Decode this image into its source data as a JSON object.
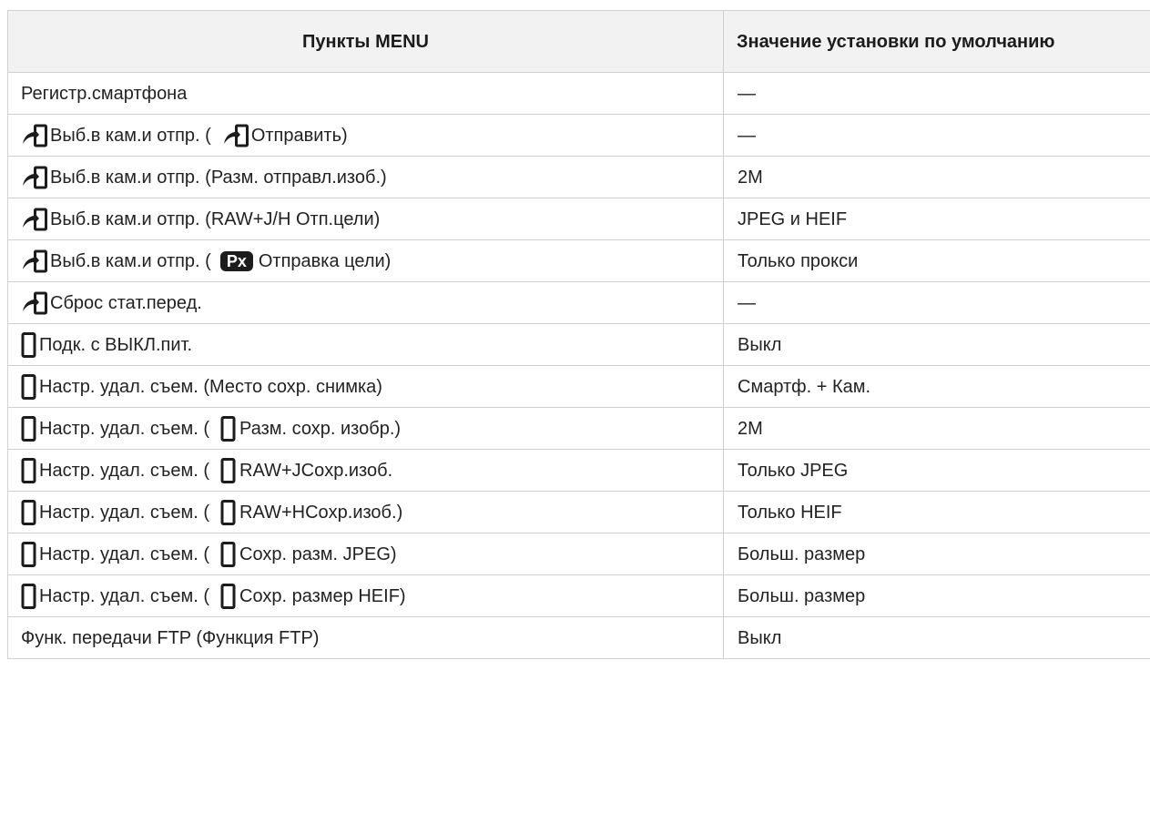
{
  "table": {
    "headers": {
      "menu": "Пункты MENU",
      "default": "Значение установки по умолчанию"
    },
    "rows": [
      {
        "icon": "",
        "parts": [
          "Регистр.смартфона"
        ],
        "value": "—"
      },
      {
        "icon": "send-icon",
        "parts": [
          "Выб.в кам.и отпр. (",
          "Отправить)"
        ],
        "inner_icon": "send-icon",
        "value": "—"
      },
      {
        "icon": "send-icon",
        "parts": [
          "Выб.в кам.и отпр. (Разм. отправл.изоб.)"
        ],
        "value": "2M"
      },
      {
        "icon": "send-icon",
        "parts": [
          "Выб.в кам.и отпр. (RAW+J/H Отп.цели)"
        ],
        "value": "JPEG и HEIF"
      },
      {
        "icon": "send-icon",
        "parts": [
          "Выб.в кам.и отпр. (",
          "Отправка цели)"
        ],
        "inner_badge": "Px",
        "value": "Только прокси"
      },
      {
        "icon": "send-icon",
        "parts": [
          "Сброс стат.перед."
        ],
        "value": "—"
      },
      {
        "icon": "smartphone-icon",
        "parts": [
          "Подк. с ВЫКЛ.пит."
        ],
        "value": "Выкл"
      },
      {
        "icon": "smartphone-icon",
        "parts": [
          "Настр. удал. съем. (Место сохр. снимка)"
        ],
        "value": "Смартф. + Кам."
      },
      {
        "icon": "smartphone-icon",
        "parts": [
          "Настр. удал. съем. (",
          "Разм. сохр. изобр.)"
        ],
        "inner_icon": "smartphone-icon",
        "value": "2M"
      },
      {
        "icon": "smartphone-icon",
        "parts": [
          "Настр. удал. съем. (",
          "RAW+JCoxp.изоб."
        ],
        "inner_icon": "smartphone-icon",
        "value": "Только JPEG"
      },
      {
        "icon": "smartphone-icon",
        "parts": [
          "Настр. удал. съем. (",
          "RAW+HCoxp.изоб.)"
        ],
        "inner_icon": "smartphone-icon",
        "value": "Только HEIF"
      },
      {
        "icon": "smartphone-icon",
        "parts": [
          "Настр. удал. съем. (",
          "Сохр. разм. JPEG)"
        ],
        "inner_icon": "smartphone-icon",
        "value": "Больш. размер"
      },
      {
        "icon": "smartphone-icon",
        "parts": [
          "Настр. удал. съем. (",
          "Сохр. размер HEIF)"
        ],
        "inner_icon": "smartphone-icon",
        "value": "Больш. размер"
      },
      {
        "icon": "",
        "parts": [
          "Функ. передачи FTP (Функция FTP)"
        ],
        "value": "Выкл"
      }
    ]
  }
}
